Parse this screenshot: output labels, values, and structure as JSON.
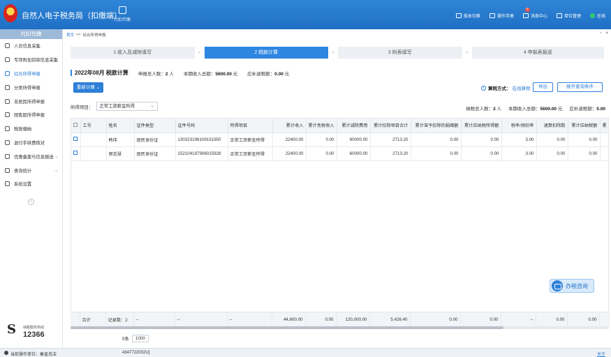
{
  "header": {
    "title": "自然人电子税务局（扣缴端）",
    "module": "代扣代缴",
    "links": [
      "版本切换",
      "操作手册",
      "消息中心",
      "单位管理",
      "在线"
    ],
    "message_badge": "5"
  },
  "sidebar": {
    "heading": "代扣代缴",
    "items": [
      {
        "label": "人员信息采集",
        "icon": "person-icon"
      },
      {
        "label": "专项附加扣除信息采集",
        "icon": "form-icon"
      },
      {
        "label": "综合所得申报",
        "icon": "layers-icon"
      },
      {
        "label": "分类所得申报",
        "icon": "chat-icon"
      },
      {
        "label": "非居民所得申报",
        "icon": "chart-icon"
      },
      {
        "label": "限售股所得申报",
        "icon": "box-icon"
      },
      {
        "label": "税款缴纳",
        "icon": "folder-icon"
      },
      {
        "label": "退付手续费核对",
        "icon": "document-icon"
      },
      {
        "label": "优惠备案与信息报送",
        "icon": "clipboard-icon"
      },
      {
        "label": "查询统计",
        "icon": "bar-chart-icon"
      },
      {
        "label": "系统设置",
        "icon": "gear-icon"
      }
    ],
    "hotline_label": "纳税服务热线",
    "hotline_number": "12366"
  },
  "breadcrumb": {
    "home": "首页",
    "sep": ">>",
    "current": "综合所得申报"
  },
  "steps": [
    "1 收入及减除填写",
    "2 税款计算",
    "3 附表填写",
    "4 申报表报送"
  ],
  "summary": {
    "period_title": "2022年08月 税款计算",
    "declare_count_label": "申报总人数：",
    "declare_count_value": "2",
    "declare_count_unit": "人",
    "income_label": "本期收入总额：",
    "income_value": "5600.00",
    "income_unit": "元",
    "tax_label": "应补退税额：",
    "tax_value": "0.00",
    "tax_unit": "元"
  },
  "toolbar": {
    "recalc_label": "重新计算",
    "calc_mode_label": "算税方式：",
    "calc_mode_value": "在线算税",
    "export_label": "导出",
    "expand_label": "展开查询条件"
  },
  "filter": {
    "label": "所得项目：",
    "selected": "正常工资薪金所得"
  },
  "right_summary": {
    "tax_count_label": "纳税总人数：",
    "tax_count_value": "2",
    "tax_count_unit": "人",
    "income_label": "本期收入总额：",
    "income_value": "5600.00",
    "income_unit": "元",
    "tax_label": "应补退税额：",
    "tax_value": "0.00"
  },
  "table": {
    "columns": [
      "工号",
      "姓名",
      "证件类型",
      "证件号码",
      "所得项目",
      "累计收入",
      "累计免税收入",
      "累计减除费用",
      "累计扣除项目合计",
      "累计准予扣除的捐赠额",
      "累计应纳税所得额",
      "税率/预扣率",
      "速算扣除数",
      "累计应纳税额",
      "累"
    ],
    "rows": [
      [
        "",
        "韩伟",
        "居民身份证",
        "130323198109151950",
        "正常工资薪金所得",
        "22400.00",
        "0.00",
        "60000.00",
        "2713.20",
        "0.00",
        "0.00",
        "3.00",
        "0.00",
        "0.00",
        ""
      ],
      [
        "",
        "郭志慧",
        "居民身份证",
        "152104197906015928",
        "正常工资薪金所得",
        "22400.00",
        "0.00",
        "60000.00",
        "2713.20",
        "0.00",
        "0.00",
        "3.00",
        "0.00",
        "0.00",
        ""
      ]
    ],
    "total": [
      "合计",
      "记录数：2",
      "--",
      "--",
      "--",
      "44,800.00",
      "0.00",
      "120,000.00",
      "5,426.40",
      "0.00",
      "0.00",
      "--",
      "0.00",
      "0.00",
      ""
    ]
  },
  "pagination": {
    "label": "5条",
    "size": "1000"
  },
  "consult_label": "办税咨询",
  "footer": {
    "unit_label": "当前操作单位：秦皇岛洁",
    "id": "4347722002U]",
    "about": "关于"
  }
}
